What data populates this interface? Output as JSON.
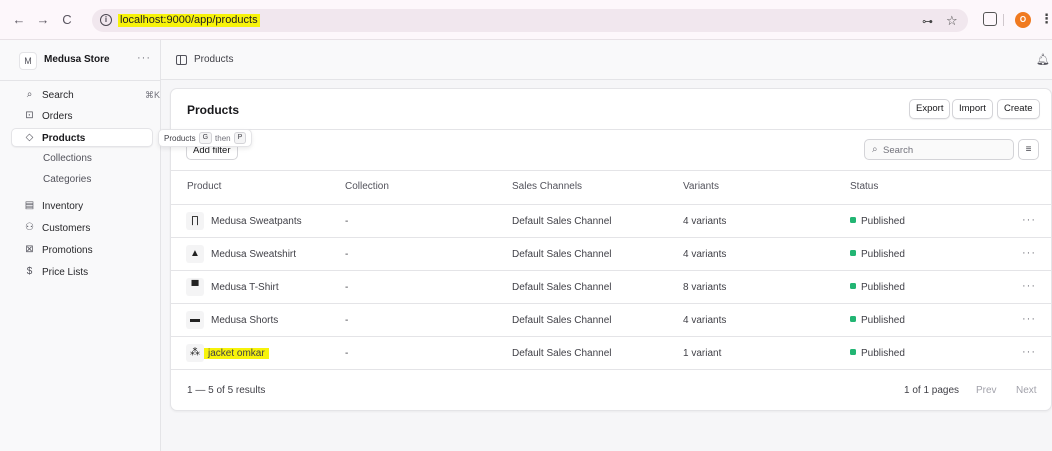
{
  "browser": {
    "back_glyph": "←",
    "forward_glyph": "→",
    "reload_glyph": "C",
    "info_glyph": "i",
    "url": "localhost:9000/app/products",
    "key_glyph": "⊶",
    "star_glyph": "☆",
    "profile_initial": "O",
    "menu_glyph": "⋮"
  },
  "store": {
    "badge": "M",
    "name": "Medusa Store",
    "more": "···"
  },
  "sidebar": {
    "search": {
      "icon": "search-icon",
      "glyph": "⌕",
      "label": "Search",
      "shortcut": "⌘K"
    },
    "items": [
      {
        "icon": "orders-icon",
        "glyph": "⊡",
        "label": "Orders"
      },
      {
        "icon": "tag-icon",
        "glyph": "◇",
        "label": "Products"
      },
      {
        "icon": "inventory-icon",
        "glyph": "▤",
        "label": "Inventory"
      },
      {
        "icon": "customers-icon",
        "glyph": "⚇",
        "label": "Customers"
      },
      {
        "icon": "promotions-icon",
        "glyph": "⊠",
        "label": "Promotions"
      },
      {
        "icon": "price-lists-icon",
        "glyph": "$",
        "label": "Price Lists"
      }
    ],
    "sub_items": [
      "Collections",
      "Categories"
    ]
  },
  "tooltip": {
    "label": "Products",
    "key1": "G",
    "then": "then",
    "key2": "P"
  },
  "topbar": {
    "breadcrumb": "Products",
    "bell_glyph": "♫"
  },
  "card": {
    "title": "Products",
    "export_label": "Export",
    "import_label": "Import",
    "create_label": "Create",
    "filter_label": "Add filter",
    "search_icon_glyph": "⌕",
    "search_placeholder": "Search",
    "sort_glyph": "≡"
  },
  "table": {
    "headers": [
      "Product",
      "Collection",
      "Sales Channels",
      "Variants",
      "Status"
    ],
    "rows": [
      {
        "thumb": "∏",
        "product": "Medusa Sweatpants",
        "collection": "-",
        "channel": "Default Sales Channel",
        "variants": "4 variants",
        "status": "Published",
        "more": "···"
      },
      {
        "thumb": "▲",
        "product": "Medusa Sweatshirt",
        "collection": "-",
        "channel": "Default Sales Channel",
        "variants": "4 variants",
        "status": "Published",
        "more": "···"
      },
      {
        "thumb": "▀",
        "product": "Medusa T-Shirt",
        "collection": "-",
        "channel": "Default Sales Channel",
        "variants": "8 variants",
        "status": "Published",
        "more": "···"
      },
      {
        "thumb": "▬",
        "product": "Medusa Shorts",
        "collection": "-",
        "channel": "Default Sales Channel",
        "variants": "4 variants",
        "status": "Published",
        "more": "···"
      },
      {
        "thumb": "⁂",
        "product": "jacket omkar",
        "collection": "-",
        "channel": "Default Sales Channel",
        "variants": "1 variant",
        "status": "Published",
        "more": "···"
      }
    ]
  },
  "footer": {
    "count": "1 — 5 of 5 results",
    "pages": "1 of 1 pages",
    "prev": "Prev",
    "next": "Next"
  },
  "colors": {
    "published": "#22b573",
    "highlight": "#f7f30a"
  }
}
